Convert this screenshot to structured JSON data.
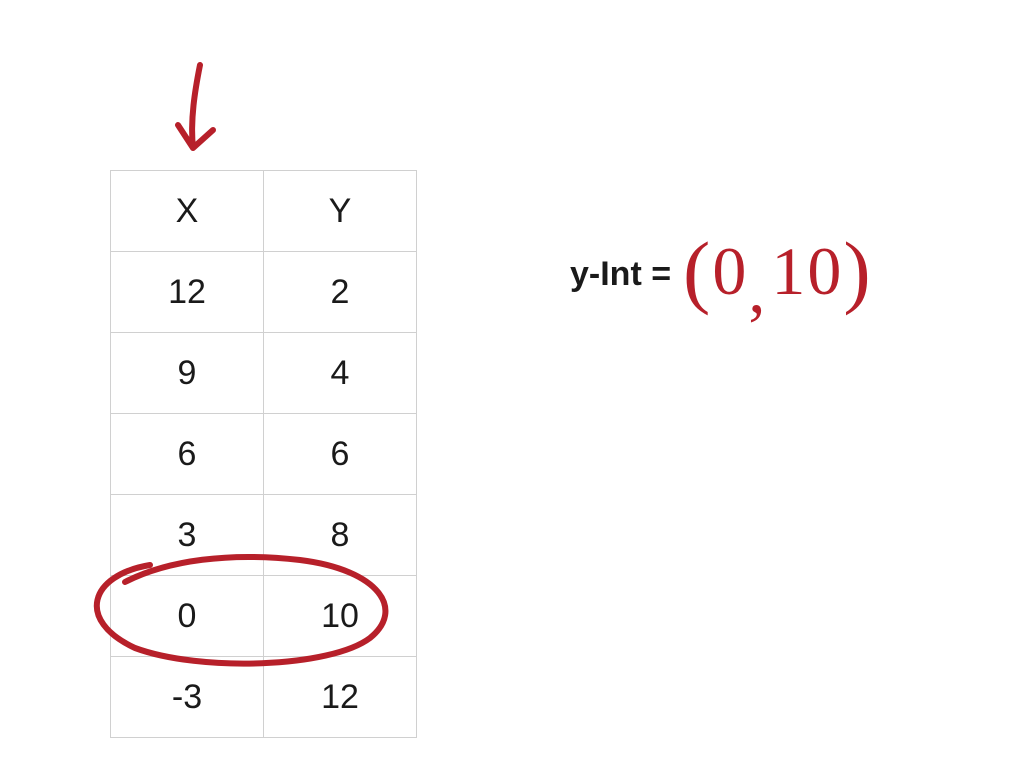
{
  "table": {
    "headers": {
      "x": "X",
      "y": "Y"
    },
    "rows": [
      {
        "x": "12",
        "y": "2"
      },
      {
        "x": "9",
        "y": "4"
      },
      {
        "x": "6",
        "y": "6"
      },
      {
        "x": "3",
        "y": "8"
      },
      {
        "x": "0",
        "y": "10"
      },
      {
        "x": "-3",
        "y": "12"
      }
    ]
  },
  "equation": {
    "label": "y-Int  =",
    "answer_open": "(",
    "answer_x": "0",
    "answer_comma": ",",
    "answer_y": "10",
    "answer_close": ")"
  },
  "annotations": {
    "arrow_color": "#b7202a",
    "highlight_row_index": 4
  },
  "chart_data": {
    "type": "table",
    "columns": [
      "X",
      "Y"
    ],
    "rows": [
      [
        12,
        2
      ],
      [
        9,
        4
      ],
      [
        6,
        6
      ],
      [
        3,
        8
      ],
      [
        0,
        10
      ],
      [
        -3,
        12
      ]
    ],
    "highlight": {
      "row": 4,
      "note": "y-intercept (0,10)"
    }
  }
}
